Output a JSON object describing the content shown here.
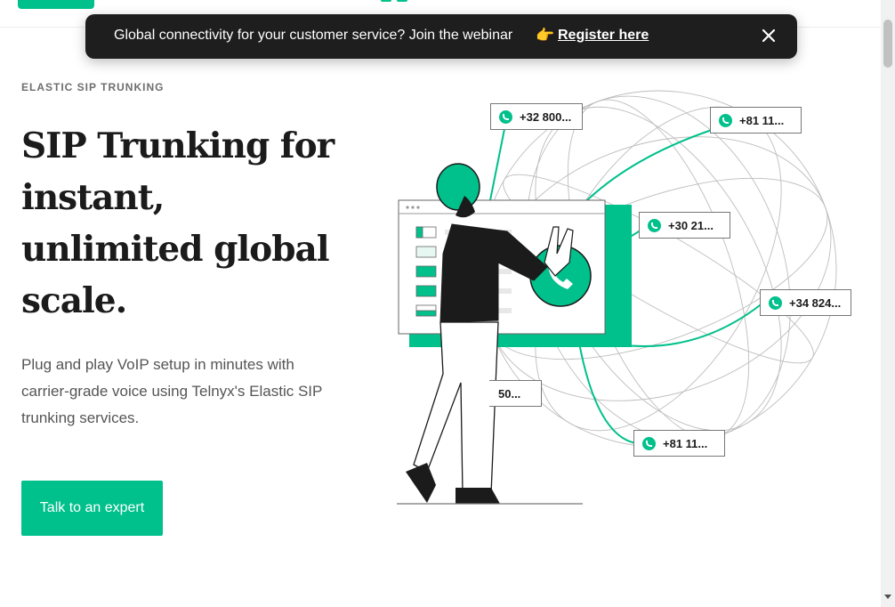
{
  "banner": {
    "message": "Global connectivity for your customer service? Join the webinar",
    "emoji": "👉",
    "link_label": "Register here"
  },
  "hero": {
    "eyebrow": "ELASTIC SIP TRUNKING",
    "headline_lines": [
      "SIP Trunking for",
      "instant,",
      "unlimited global",
      "scale."
    ],
    "description": "Plug and play VoIP setup in minutes with carrier-grade voice using Telnyx's Elastic SIP trunking services.",
    "cta_label": "Talk to an expert"
  },
  "illustration": {
    "phone_numbers": [
      "+32 800...",
      "+81 11...",
      "+30 21...",
      "+34 824...",
      "50...",
      "+81 11..."
    ]
  },
  "colors": {
    "accent": "#00c08b",
    "banner_bg": "#1e1e1f",
    "text": "#1b1b1b"
  },
  "icons": [
    "phone-icon",
    "close-icon",
    "pointing-hand-emoji",
    "globe-illustration"
  ]
}
